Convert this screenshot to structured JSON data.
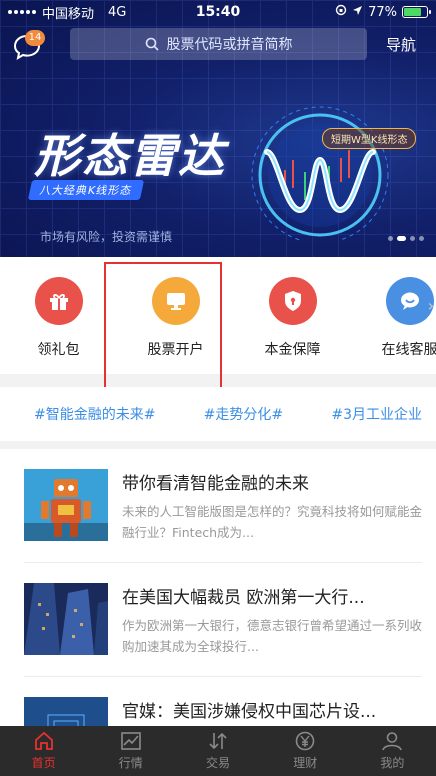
{
  "status_bar": {
    "carrier": "中国移动",
    "network": "4G",
    "time": "15:40",
    "battery": "77%",
    "battery_level": 0.77
  },
  "header": {
    "message_badge": "14",
    "search_placeholder": "股票代码或拼音简称",
    "nav_label": "导航"
  },
  "banner": {
    "title": "形态雷达",
    "subtitle": "八大经典K线形态",
    "tag": "短期W型K线形态",
    "risk_note": "市场有风险，投资需谨慎"
  },
  "quick_entries": [
    {
      "label": "领礼包",
      "icon": "gift-icon",
      "color": "#e8524a"
    },
    {
      "label": "股票开户",
      "icon": "monitor-icon",
      "color": "#f5a93a"
    },
    {
      "label": "本金保障",
      "icon": "shield-icon",
      "color": "#e8524a"
    },
    {
      "label": "在线客服",
      "icon": "chat-bubble-icon",
      "color": "#4a90e2"
    }
  ],
  "hashtags": [
    "#智能金融的未来#",
    "#走势分化#",
    "#3月工业企业"
  ],
  "news": [
    {
      "title": "带你看清智能金融的未来",
      "summary": "未来的人工智能版图是怎样的？究竟科技将如何赋能金融行业？Fintech成为..."
    },
    {
      "title": "在美国大幅裁员 欧洲第一大行...",
      "summary": "作为欧洲第一大银行，德意志银行曾希望通过一系列收购加速其成为全球投行..."
    },
    {
      "title": "官媒：美国涉嫌侵权中国芯片设...",
      "summary": ""
    }
  ],
  "tabbar": [
    {
      "label": "首页",
      "icon": "home-icon",
      "active": true
    },
    {
      "label": "行情",
      "icon": "chart-icon",
      "active": false
    },
    {
      "label": "交易",
      "icon": "exchange-icon",
      "active": false
    },
    {
      "label": "理财",
      "icon": "yen-icon",
      "active": false
    },
    {
      "label": "我的",
      "icon": "user-icon",
      "active": false
    }
  ],
  "colors": {
    "accent": "#e8312e",
    "link": "#3a8ee6",
    "tabbar_bg": "#2b2b2b"
  }
}
